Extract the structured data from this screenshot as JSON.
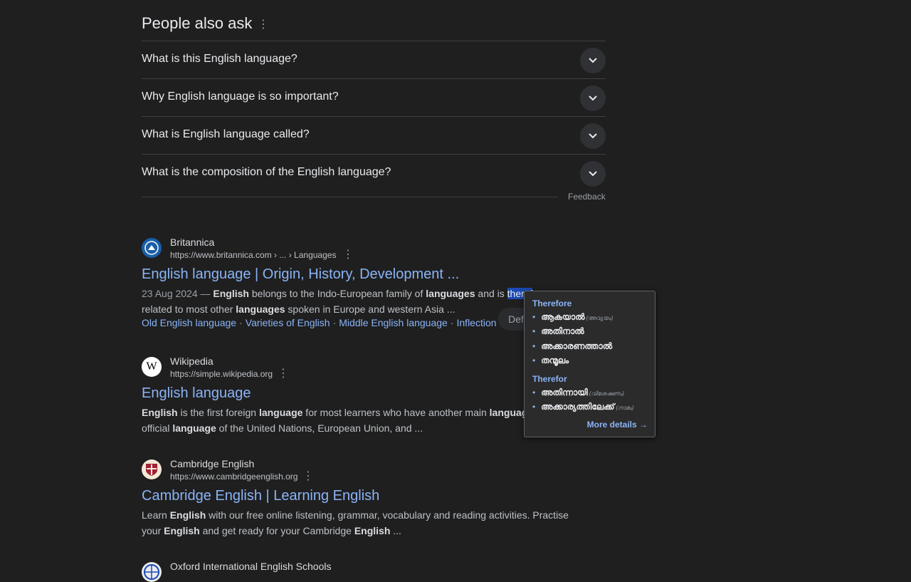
{
  "paa": {
    "title": "People also ask",
    "questions": [
      "What is this English language?",
      "Why English language is so important?",
      "What is English language called?",
      "What is the composition of the English language?"
    ],
    "feedback": "Feedback"
  },
  "results": [
    {
      "site": "Britannica",
      "url": "https://www.britannica.com › ... › Languages",
      "title": "English language | Origin, History, Development ...",
      "snippet_date": "23 Aug 2024 —",
      "snippet_parts": [
        "English",
        " belongs to the Indo-European family of ",
        "languages",
        " and is ",
        "theref",
        "related to most other ",
        "languages",
        " spoken in Europe and western Asia ..."
      ],
      "links": [
        "Old English language",
        "Varieties of English",
        "Middle English language",
        "Inflection"
      ]
    },
    {
      "site": "Wikipedia",
      "url": "https://simple.wikipedia.org",
      "title": "English language",
      "snippet_parts": [
        "English",
        " is the first foreign ",
        "language",
        " for most learners who have another main ",
        "languag",
        "official ",
        "language",
        " of the United Nations, European Union, and ..."
      ]
    },
    {
      "site": "Cambridge English",
      "url": "https://www.cambridgeenglish.org",
      "title": "Cambridge English | Learning English",
      "snippet_parts": [
        "Learn ",
        "English",
        " with our free online listening, grammar, vocabulary and reading activities. Practise",
        "your ",
        "English",
        " and get ready for your Cambridge ",
        "English",
        " ..."
      ]
    },
    {
      "site": "Oxford International English Schools"
    }
  ],
  "define_pill": "Define",
  "dictionary_popup": {
    "word1": "Therefore",
    "word1_meanings": [
      "ആകയാൽ",
      "അതിനാൽ",
      "അക്കാരണത്താൽ",
      "തന്മൂലം"
    ],
    "word1_pos": "(അവ്യയം)",
    "word2": "Therefor",
    "word2_meanings": [
      "അതിന്നായി",
      "അക്കാര്യത്തിലേക്ക്"
    ],
    "word2_pos": [
      "(വിശേഷണം)",
      "(നാമം)"
    ],
    "more": "More details →"
  },
  "colors": {
    "background": "#1f1f1f",
    "link": "#8ab4f8",
    "highlight": "#1a4ab3"
  }
}
